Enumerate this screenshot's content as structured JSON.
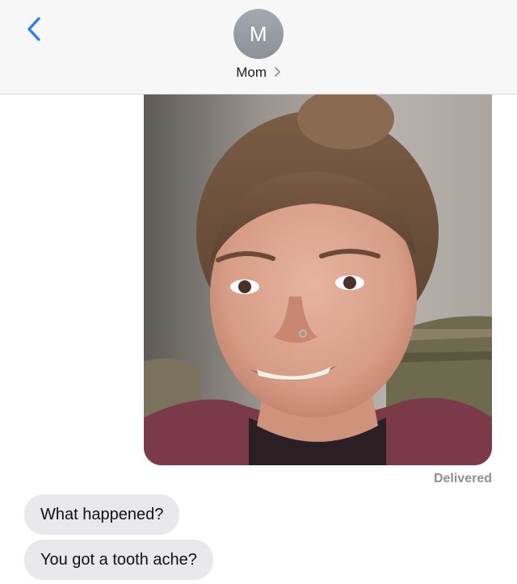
{
  "header": {
    "avatar_initial": "M",
    "contact_name": "Mom",
    "back_icon": "chevron-left-icon",
    "name_chevron_icon": "chevron-right-icon"
  },
  "thread": {
    "sent_photo": {
      "status": "Delivered"
    },
    "incoming_messages": [
      {
        "text": "What happened?"
      },
      {
        "text": "You got a tooth ache?"
      }
    ]
  },
  "colors": {
    "accent": "#2f7cf6",
    "header_bg": "#f7f7f7",
    "incoming_bubble": "#e9e9eb",
    "status_text": "#8e8e93",
    "avatar_bg": "#9a9ea6"
  }
}
